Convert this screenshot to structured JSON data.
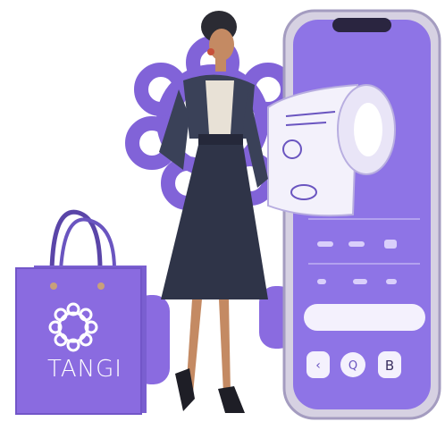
{
  "bag": {
    "brand_text": "TANGI",
    "logo": "flower-ring-logo"
  },
  "colors": {
    "brand_purple": "#7b5bd6",
    "bag_purple": "#8a6be0",
    "phone_screen": "#8e74e6",
    "phone_frame": "#c9c3d8",
    "dress": "#2f3448",
    "background": "#ffffff"
  },
  "phone": {
    "receipt_icon": "receipt-scroll-icon",
    "screen_button": "pill-button",
    "nav_icons": [
      "back-icon",
      "search-icon",
      "bitcoin-icon"
    ]
  }
}
